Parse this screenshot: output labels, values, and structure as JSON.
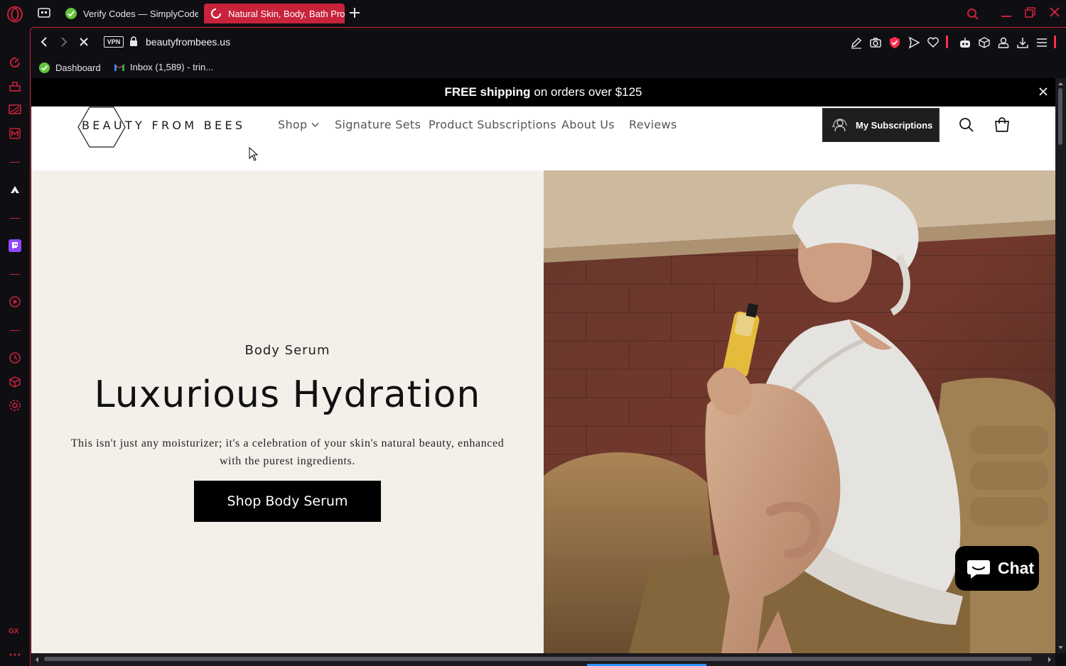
{
  "browser": {
    "tabs": [
      {
        "label": "Verify Codes — SimplyCodes",
        "active": false
      },
      {
        "label": "Natural Skin, Body, Bath Products",
        "active": true
      }
    ],
    "address": {
      "vpn_label": "VPN",
      "url": "beautyfrombees.us"
    },
    "bookmarks": [
      {
        "label": "Dashboard",
        "icon": "simplycodes-icon"
      },
      {
        "label": "Inbox (1,589) - trin...",
        "icon": "gmail-icon"
      }
    ],
    "accent_color": "#c8233b"
  },
  "page": {
    "announcement": {
      "bold": "FREE shipping",
      "rest": "on orders over $125"
    },
    "logo_text": "BEAUTY FROM BEES",
    "nav": [
      {
        "label": "Shop",
        "has_dropdown": true
      },
      {
        "label": "Signature Sets"
      },
      {
        "label": "Product Subscriptions"
      },
      {
        "label": "About Us"
      },
      {
        "label": "Reviews"
      }
    ],
    "subscriptions_button": "My Subscriptions",
    "hero": {
      "eyebrow": "Body Serum",
      "title": "Luxurious Hydration",
      "description": "This isn't just any moisturizer; it's a celebration of your skin's natural beauty, enhanced with the purest ingredients.",
      "cta": "Shop Body Serum",
      "background_color": "#f3f0ea"
    },
    "chat_button": "Chat"
  }
}
